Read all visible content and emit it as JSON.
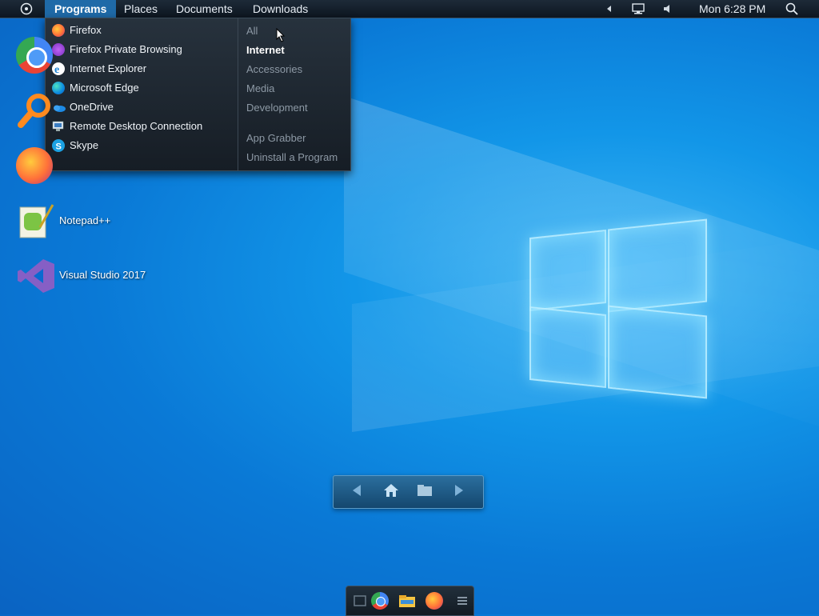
{
  "topbar": {
    "menus": [
      "Programs",
      "Places",
      "Documents",
      "Downloads"
    ],
    "clock": "Mon 6:28 PM",
    "icons": [
      "system-menu-icon",
      "tray-collapse-icon",
      "network-icon",
      "volume-icon",
      "search-icon"
    ]
  },
  "programs_menu": {
    "items": [
      {
        "label": "Firefox",
        "icon": "firefox-icon"
      },
      {
        "label": "Firefox Private Browsing",
        "icon": "firefox-private-icon"
      },
      {
        "label": "Internet Explorer",
        "icon": "internet-explorer-icon"
      },
      {
        "label": "Microsoft Edge",
        "icon": "edge-icon"
      },
      {
        "label": "OneDrive",
        "icon": "onedrive-icon"
      },
      {
        "label": "Remote Desktop Connection",
        "icon": "remote-desktop-icon"
      },
      {
        "label": "Skype",
        "icon": "skype-icon"
      }
    ],
    "categories": [
      "All",
      "Internet",
      "Accessories",
      "Media",
      "Development"
    ],
    "selected_category": "Internet",
    "extras": [
      "App Grabber",
      "Uninstall a Program"
    ]
  },
  "desktop": {
    "icons": [
      {
        "label": "",
        "icon": "chrome-icon"
      },
      {
        "label": "",
        "icon": "search-app-icon"
      },
      {
        "label": "",
        "icon": "firefox-icon"
      },
      {
        "label": "Notepad++",
        "icon": "notepadpp-icon"
      },
      {
        "label": "Visual Studio 2017",
        "icon": "visual-studio-icon"
      }
    ]
  },
  "navdock": {
    "buttons": [
      "back-icon",
      "home-icon",
      "folder-icon",
      "forward-icon"
    ]
  },
  "taskbar": {
    "icons": [
      "desktop-icon",
      "chrome-icon",
      "file-explorer-icon",
      "firefox-icon",
      "menu-icon"
    ]
  },
  "colors": {
    "accent": "#1f6aa8",
    "topbar": "#0d1620",
    "menu_bg": "#1e2730",
    "wallpaper": "#0a79d6"
  }
}
